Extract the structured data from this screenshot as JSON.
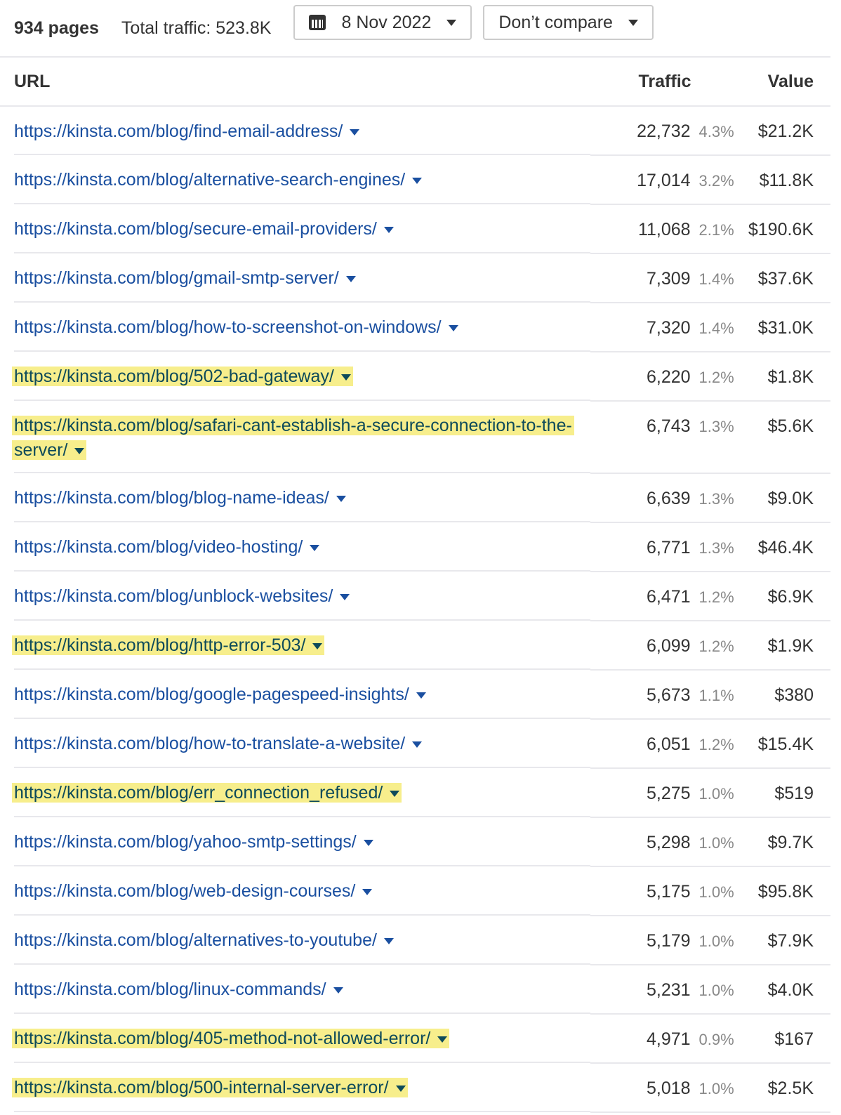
{
  "toolbar": {
    "pages": "934 pages",
    "total_traffic": "Total traffic: 523.8K",
    "date": "8 Nov 2022",
    "compare": "Don’t compare"
  },
  "columns": {
    "url": "URL",
    "traffic": "Traffic",
    "value": "Value"
  },
  "colors": {
    "link": "#1a4fa0",
    "highlight": "#f7ee8c",
    "highlight_text": "#0d4a5a"
  },
  "rows": [
    {
      "url": "https://kinsta.com/blog/find-email-address/",
      "traffic": "22,732",
      "pct": "4.3%",
      "value": "$21.2K",
      "highlighted": false
    },
    {
      "url": "https://kinsta.com/blog/alternative-search-engines/",
      "traffic": "17,014",
      "pct": "3.2%",
      "value": "$11.8K",
      "highlighted": false
    },
    {
      "url": "https://kinsta.com/blog/secure-email-providers/",
      "traffic": "11,068",
      "pct": "2.1%",
      "value": "$190.6K",
      "highlighted": false
    },
    {
      "url": "https://kinsta.com/blog/gmail-smtp-server/",
      "traffic": "7,309",
      "pct": "1.4%",
      "value": "$37.6K",
      "highlighted": false
    },
    {
      "url": "https://kinsta.com/blog/how-to-screenshot-on-windows/",
      "traffic": "7,320",
      "pct": "1.4%",
      "value": "$31.0K",
      "highlighted": false
    },
    {
      "url": "https://kinsta.com/blog/502-bad-gateway/",
      "traffic": "6,220",
      "pct": "1.2%",
      "value": "$1.8K",
      "highlighted": true
    },
    {
      "url": "https://kinsta.com/blog/safari-cant-establish-a-secure-connection-to-the-server/",
      "traffic": "6,743",
      "pct": "1.3%",
      "value": "$5.6K",
      "highlighted": true
    },
    {
      "url": "https://kinsta.com/blog/blog-name-ideas/",
      "traffic": "6,639",
      "pct": "1.3%",
      "value": "$9.0K",
      "highlighted": false
    },
    {
      "url": "https://kinsta.com/blog/video-hosting/",
      "traffic": "6,771",
      "pct": "1.3%",
      "value": "$46.4K",
      "highlighted": false
    },
    {
      "url": "https://kinsta.com/blog/unblock-websites/",
      "traffic": "6,471",
      "pct": "1.2%",
      "value": "$6.9K",
      "highlighted": false
    },
    {
      "url": "https://kinsta.com/blog/http-error-503/",
      "traffic": "6,099",
      "pct": "1.2%",
      "value": "$1.9K",
      "highlighted": true
    },
    {
      "url": "https://kinsta.com/blog/google-pagespeed-insights/",
      "traffic": "5,673",
      "pct": "1.1%",
      "value": "$380",
      "highlighted": false
    },
    {
      "url": "https://kinsta.com/blog/how-to-translate-a-website/",
      "traffic": "6,051",
      "pct": "1.2%",
      "value": "$15.4K",
      "highlighted": false
    },
    {
      "url": "https://kinsta.com/blog/err_connection_refused/",
      "traffic": "5,275",
      "pct": "1.0%",
      "value": "$519",
      "highlighted": true
    },
    {
      "url": "https://kinsta.com/blog/yahoo-smtp-settings/",
      "traffic": "5,298",
      "pct": "1.0%",
      "value": "$9.7K",
      "highlighted": false
    },
    {
      "url": "https://kinsta.com/blog/web-design-courses/",
      "traffic": "5,175",
      "pct": "1.0%",
      "value": "$95.8K",
      "highlighted": false
    },
    {
      "url": "https://kinsta.com/blog/alternatives-to-youtube/",
      "traffic": "5,179",
      "pct": "1.0%",
      "value": "$7.9K",
      "highlighted": false
    },
    {
      "url": "https://kinsta.com/blog/linux-commands/",
      "traffic": "5,231",
      "pct": "1.0%",
      "value": "$4.0K",
      "highlighted": false
    },
    {
      "url": "https://kinsta.com/blog/405-method-not-allowed-error/",
      "traffic": "4,971",
      "pct": "0.9%",
      "value": "$167",
      "highlighted": true
    },
    {
      "url": "https://kinsta.com/blog/500-internal-server-error/",
      "traffic": "5,018",
      "pct": "1.0%",
      "value": "$2.5K",
      "highlighted": true
    }
  ]
}
